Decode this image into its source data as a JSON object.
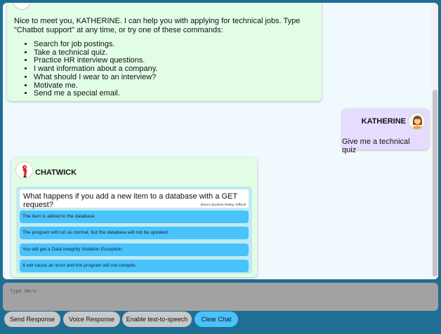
{
  "conversation": {
    "bot_intro": {
      "text": "Nice to meet you, KATHERINE. I can help you with applying for technical jobs. Type \"Chatbot support\" at any time, or try one of these commands:",
      "commands": [
        "Search for job postings.",
        "Take a technical quiz.",
        "Practice HR interview questions.",
        "I want information about a company.",
        "What should I wear to an interview?",
        "Motivate me.",
        "Send me a special email."
      ]
    },
    "user_message": {
      "name": "KATHERINE",
      "text": "Give me a technical quiz"
    },
    "bot_quiz": {
      "name": "CHATWICK",
      "question": "What happens if you add a new item to a database with a GET request?",
      "rating": "Brian's Question Rating: Difficult",
      "answers": [
        "The item is added to the database",
        "The program will run as normal, but the database will not be updated.",
        "You will get a Data Integrity Violation Exception.",
        "It will cause an error and the program will not compile."
      ]
    }
  },
  "input": {
    "placeholder": "Type Here",
    "value": ""
  },
  "buttons": {
    "send": "Send Response",
    "voice": "Voice Response",
    "tts": "Enable text-to-speech",
    "clear": "Clear Chat"
  },
  "colors": {
    "background": "#1f6e93",
    "chat_bg": "#f0f9fd",
    "bot_bubble": "#e1fde6",
    "user_bubble": "#e6dcff",
    "answer_bg": "#4ac2fb",
    "accent_button": "#4ac2fb",
    "default_button": "#c8c8c8"
  },
  "icons": {
    "user_avatar": "user-avatar-icon",
    "bot_avatar": "chatwick-logo-icon"
  }
}
